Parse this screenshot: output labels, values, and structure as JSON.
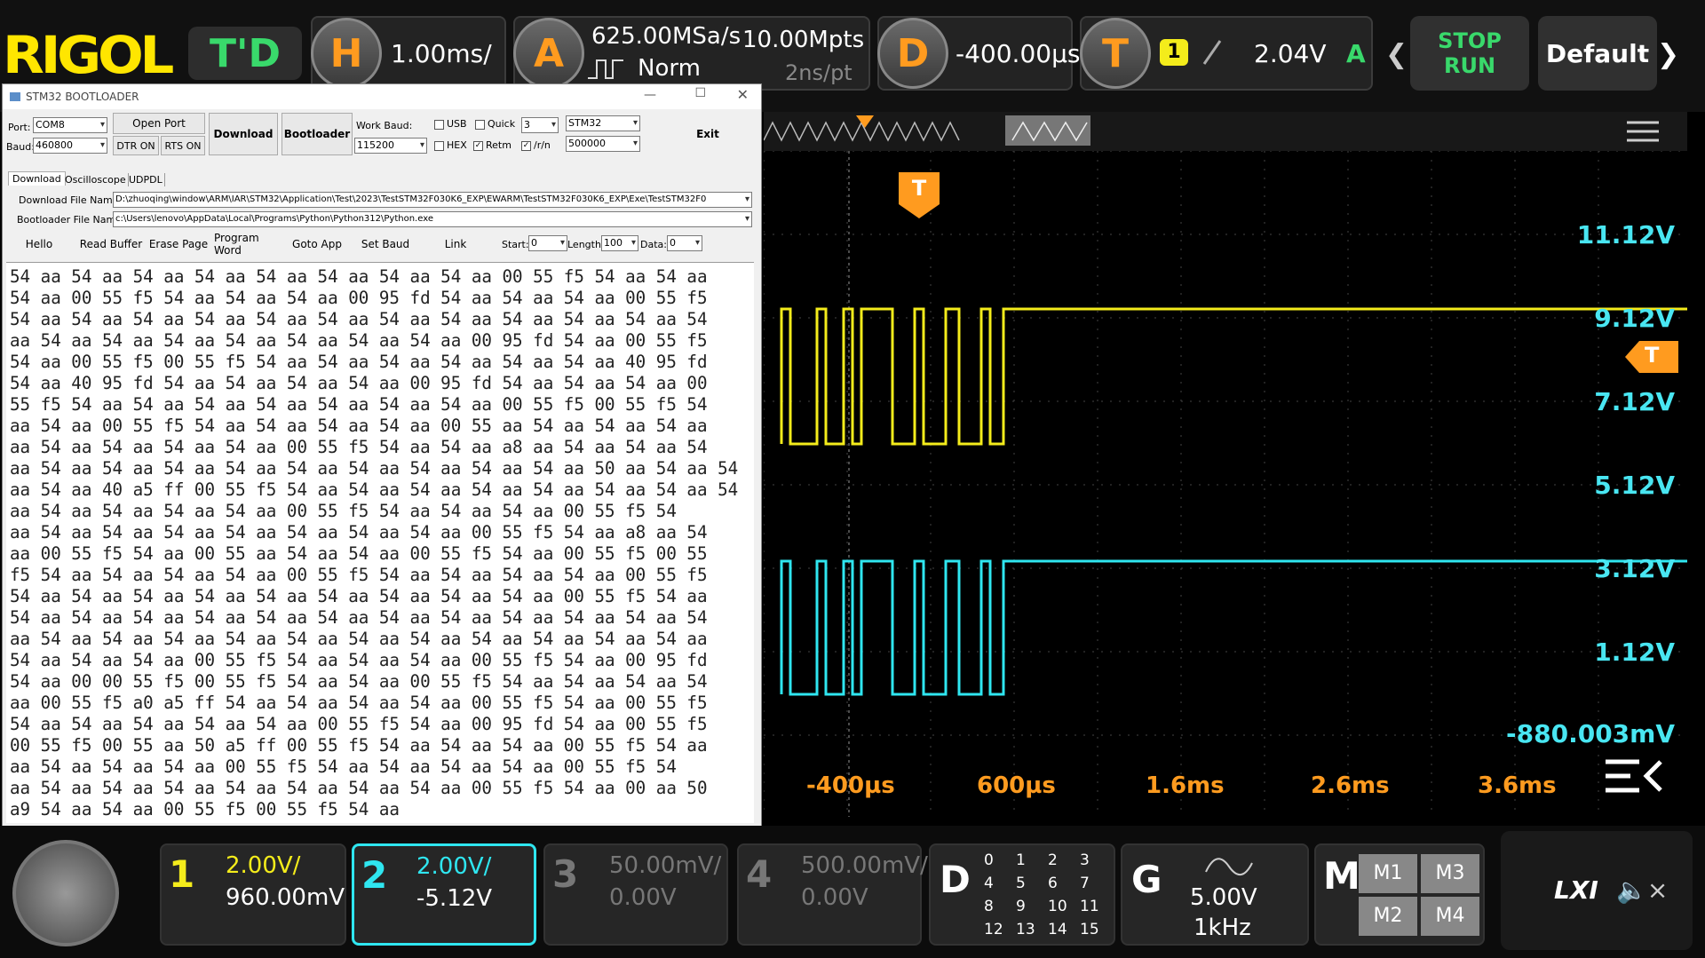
{
  "topbar": {
    "logo": "RIGOL",
    "mode": "T'D",
    "h_letter": "H",
    "timebase": "1.00ms/",
    "a_letter": "A",
    "sample_rate": "625.00MSa/s",
    "mem_depth": "10.00Mpts",
    "acq_mode": "Norm",
    "pt_time": "2ns/pt",
    "d_letter": "D",
    "delay": "-400.00µs",
    "t_letter": "T",
    "trig_chan": "1",
    "trig_level": "2.04V",
    "trig_state": "A",
    "stop_label": "STOP",
    "run_label": "RUN",
    "default_label": "Default"
  },
  "window": {
    "title": "STM32 BOOTLOADER",
    "port_label": "Port:",
    "port_value": "COM8",
    "baud_label": "Baud:",
    "baud_value": "460800",
    "open_port": "Open Port",
    "dtr": "DTR ON",
    "rts": "RTS ON",
    "download": "Download",
    "bootloader": "Bootloader",
    "work_baud_label": "Work Baud:",
    "work_baud_value": "115200",
    "usb": "USB",
    "quick": "Quick",
    "quick_value": "3",
    "chip": "STM32",
    "hex": "HEX",
    "retm": "Retm",
    "rn": "/r/n",
    "rate_value": "500000",
    "exit": "Exit",
    "tabs": [
      "Download",
      "Oscilloscope",
      "UDPDL"
    ],
    "dl_file_label": "Download File Name:",
    "dl_file_value": "D:\\zhuoqing\\window\\ARM\\IAR\\STM32\\Application\\Test\\2023\\TestSTM32F030K6_EXP\\EWARM\\TestSTM32F030K6_EXP\\Exe\\TestSTM32F0",
    "bl_file_label": "Bootloader File Name:",
    "bl_file_value": "c:\\Users\\lenovo\\AppData\\Local\\Programs\\Python\\Python312\\Python.exe",
    "buttons": [
      "Hello",
      "Read Buffer",
      "Erase Page",
      "Program Word",
      "Goto App",
      "Set Baud",
      "Link"
    ],
    "start_label": "Start:",
    "start_value": "0",
    "length_label": "Length:",
    "length_value": "100",
    "data_label": "Data:",
    "data_value": "0",
    "hex_lines": [
      "54 aa 54 aa 54 aa 54 aa 54 aa 54 aa 54 aa 54 aa 00 55 f5 54 aa 54 aa",
      "54 aa 00 55 f5 54 aa 54 aa 54 aa 00 95 fd 54 aa 54 aa 54 aa 00 55 f5",
      "54 aa 54 aa 54 aa 54 aa 54 aa 54 aa 54 aa 54 aa 54 aa 54 aa 54 aa 54",
      "aa 54 aa 54 aa 54 aa 54 aa 54 aa 54 aa 54 aa 00 95 fd 54 aa 00 55 f5",
      "54 aa 00 55 f5 00 55 f5 54 aa 54 aa 54 aa 54 aa 54 aa 54 aa 40 95 fd",
      "54 aa 40 95 fd 54 aa 54 aa 54 aa 54 aa 00 95 fd 54 aa 54 aa 54 aa 00",
      "55 f5 54 aa 54 aa 54 aa 54 aa 54 aa 54 aa 54 aa 00 55 f5 00 55 f5 54",
      "aa 54 aa 00 55 f5 54 aa 54 aa 54 aa 54 aa 00 55 aa 54 aa 54 aa 54 aa",
      "aa 54 aa 54 aa 54 aa 54 aa 00 55 f5 54 aa 54 aa a8 aa 54 aa 54 aa 54",
      "aa 54 aa 54 aa 54 aa 54 aa 54 aa 54 aa 54 aa 54 aa 54 aa 50 aa 54 aa 54",
      "aa 54 aa 40 a5 ff 00 55 f5 54 aa 54 aa 54 aa 54 aa 54 aa 54 aa 54 aa 54",
      "aa 54 aa 54 aa 54 aa 54 aa 00 55 f5 54 aa 54 aa 54 aa 00 55 f5 54",
      "aa 54 aa 54 aa 54 aa 54 aa 54 aa 54 aa 54 aa 00 55 f5 54 aa a8 aa 54",
      "aa 00 55 f5 54 aa 00 55 aa 54 aa 54 aa 00 55 f5 54 aa 00 55 f5 00 55",
      "f5 54 aa 54 aa 54 aa 54 aa 00 55 f5 54 aa 54 aa 54 aa 54 aa 00 55 f5",
      "54 aa 54 aa 54 aa 54 aa 54 aa 54 aa 54 aa 54 aa 54 aa 00 55 f5 54 aa",
      "54 aa 54 aa 54 aa 54 aa 54 aa 54 aa 54 aa 54 aa 54 aa 54 aa 54 aa 54",
      "aa 54 aa 54 aa 54 aa 54 aa 54 aa 54 aa 54 aa 54 aa 54 aa 54 aa 54 aa",
      "54 aa 54 aa 54 aa 00 55 f5 54 aa 54 aa 54 aa 00 55 f5 54 aa 00 95 fd",
      "54 aa 00 00 55 f5 00 55 f5 54 aa 54 aa 00 55 f5 54 aa 54 aa 54 aa 54",
      "aa 00 55 f5 a0 a5 ff 54 aa 54 aa 54 aa 54 aa 00 55 f5 54 aa 00 55 f5",
      "54 aa 54 aa 54 aa 54 aa 54 aa 00 55 f5 54 aa 00 95 fd 54 aa 00 55 f5",
      "00 55 f5 00 55 aa 50 a5 ff 00 55 f5 54 aa 54 aa 54 aa 00 55 f5 54 aa",
      "aa 54 aa 54 aa 54 aa 00 55 f5 54 aa 54 aa 54 aa 54 aa 00 55 f5 54",
      "aa 54 aa 54 aa 54 aa 54 aa 54 aa 54 aa 54 aa 00 55 f5 54 aa 00 aa 50",
      "a9 54 aa 54 aa 00 55 f5 00 55 f5 54 aa"
    ]
  },
  "plot": {
    "ylabels": [
      "11.12V",
      "9.12V",
      "7.12V",
      "5.12V",
      "3.12V",
      "1.12V",
      "-880.003mV"
    ],
    "xlabels": [
      "-400µs",
      "600µs",
      "1.6ms",
      "2.6ms",
      "3.6ms"
    ],
    "trig_marker": "T",
    "colors": {
      "ch1": "#f4ec1b",
      "ch2": "#2fe6f0",
      "accent": "#ff9b1f"
    }
  },
  "bottom": {
    "ch1_num": "1",
    "ch1_scale": "2.00V/",
    "ch1_offset": "960.00mV",
    "ch2_num": "2",
    "ch2_scale": "2.00V/",
    "ch2_offset": "-5.12V",
    "ch3_num": "3",
    "ch3_scale": "50.00mV/",
    "ch3_offset": "0.00V",
    "ch4_num": "4",
    "ch4_scale": "500.00mV/",
    "ch4_offset": "0.00V",
    "d_label": "D",
    "digital": [
      "0",
      "1",
      "2",
      "3",
      "4",
      "5",
      "6",
      "7",
      "8",
      "9",
      "10",
      "11",
      "12",
      "13",
      "14",
      "15"
    ],
    "g_label": "G",
    "gen_amp": "5.00V",
    "gen_freq": "1kHz",
    "m_label": "M",
    "maths": [
      "M1",
      "M3",
      "M2",
      "M4"
    ],
    "lxi": "LXI"
  }
}
